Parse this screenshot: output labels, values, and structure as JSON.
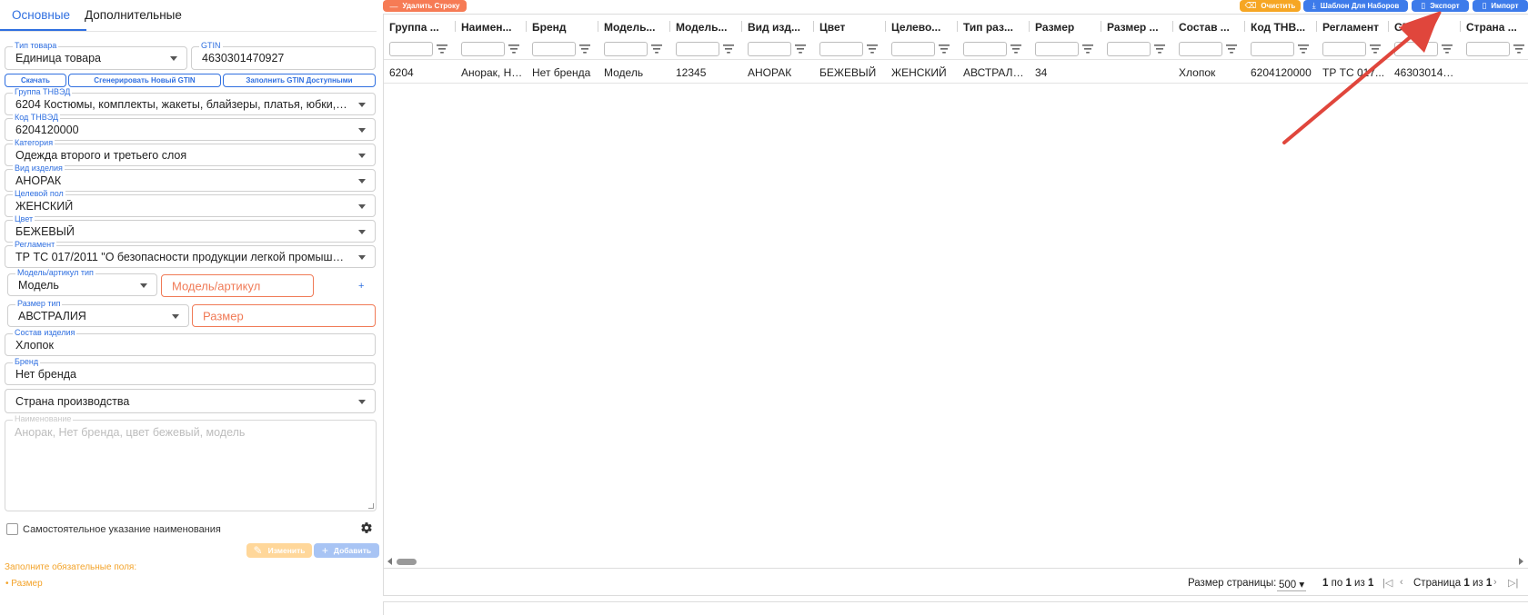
{
  "tabs": [
    {
      "label": "Основные",
      "active": true
    },
    {
      "label": "Дополнительные",
      "active": false
    }
  ],
  "form": {
    "product_type": {
      "label": "Тип товара",
      "value": "Единица товара"
    },
    "gtin": {
      "label": "GTIN",
      "value": "4630301470927"
    },
    "buttons": {
      "download": "Скачать",
      "generate": "Сгенерировать Новый GTIN",
      "fill_available": "Заполнить GTIN Доступными"
    },
    "tnved_group": {
      "label": "Группа ТНВЭД",
      "value": "6204 Костюмы, комплекты, жакеты, блайзеры, платья, юбки, ю..."
    },
    "tnved_code": {
      "label": "Код ТНВЭД",
      "value": "6204120000"
    },
    "category": {
      "label": "Категория",
      "value": "Одежда второго и третьего слоя"
    },
    "item_kind": {
      "label": "Вид изделия",
      "value": "АНОРАК"
    },
    "target_gender": {
      "label": "Целевой пол",
      "value": "ЖЕНСКИЙ"
    },
    "color": {
      "label": "Цвет",
      "value": "БЕЖЕВЫЙ"
    },
    "regulation": {
      "label": "Регламент",
      "value": "ТР ТС 017/2011 \"О безопасности продукции легкой промышлен..."
    },
    "model_type": {
      "label": "Модель/артикул тип",
      "value": "Модель"
    },
    "model_input": {
      "placeholder": "Модель/артикул"
    },
    "plus": "+",
    "size_type": {
      "label": "Размер тип",
      "value": "АВСТРАЛИЯ"
    },
    "size_input": {
      "placeholder": "Размер"
    },
    "composition": {
      "label": "Состав изделия",
      "value": "Хлопок"
    },
    "brand": {
      "label": "Бренд",
      "value": "Нет бренда"
    },
    "country": {
      "value": "Страна производства"
    },
    "name": {
      "label": "Наименование",
      "placeholder": "Анорак, Нет бренда, цвет бежевый, модель"
    },
    "self_name_label": "Самостоятельное указание наименования",
    "edit_label": "Изменить",
    "add_label": "Добавить",
    "required_title": "Заполните обязательные поля:",
    "required_items": [
      "Размер"
    ]
  },
  "toolbar": {
    "delete_row": "Удалить Строку",
    "clear": "Очистить",
    "template": "Шаблон Для Наборов",
    "export": "Экспорт",
    "import": "Импорт"
  },
  "table": {
    "columns": [
      "Группа ...",
      "Наимен...",
      "Бренд",
      "Модель...",
      "Модель...",
      "Вид изд...",
      "Цвет",
      "Целево...",
      "Тип раз...",
      "Размер",
      "Размер ...",
      "Состав ...",
      "Код ТНВ...",
      "Регламент",
      "GTIN",
      "Страна ..."
    ],
    "rows": [
      [
        "6204",
        "Анорак, Не...",
        "Нет бренда",
        "Модель",
        "12345",
        "АНОРАК",
        "БЕЖЕВЫЙ",
        "ЖЕНСКИЙ",
        "АВСТРАЛИЯ",
        "34",
        "",
        "Хлопок",
        "6204120000",
        "ТР ТС 017...",
        "4630301470927",
        ""
      ]
    ]
  },
  "pager": {
    "page_size_label": "Размер страницы:",
    "page_size": "500",
    "range_from": "1",
    "range_sep1": "по",
    "range_to": "1",
    "range_sep2": "из",
    "range_total": "1",
    "page_word": "Страница",
    "page_cur": "1",
    "page_of": "из",
    "page_total": "1"
  },
  "colors": {
    "accent": "#2f6fe0",
    "error": "#f07a56",
    "warning": "#f3a32a",
    "arrow": "#e0463c"
  }
}
